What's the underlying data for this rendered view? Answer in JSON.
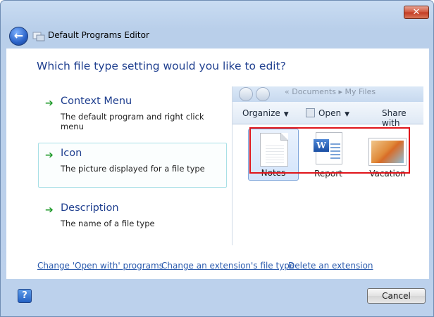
{
  "window": {
    "title": "Default Programs Editor",
    "close_label": "✕"
  },
  "main": {
    "heading": "Which file type setting would you like to edit?",
    "options": [
      {
        "title": "Context Menu",
        "description": "The default program and right click menu"
      },
      {
        "title": "Icon",
        "description": "The picture displayed for a file type",
        "selected": true
      },
      {
        "title": "Description",
        "description": "The name of a file type"
      }
    ]
  },
  "preview": {
    "address": "« Documents ▸ My Files",
    "toolbar": {
      "organize": "Organize",
      "open": "Open",
      "share": "Share with"
    },
    "files": [
      {
        "name": "Notes",
        "icon": "text-document-icon",
        "selected": true
      },
      {
        "name": "Report",
        "icon": "word-document-icon"
      },
      {
        "name": "Vacation",
        "icon": "photo-icon"
      }
    ]
  },
  "links": {
    "open_with": "Change 'Open with' programs",
    "change_type": "Change an extension's file type",
    "delete_ext": "Delete an extension"
  },
  "footer": {
    "help_label": "?",
    "cancel_label": "Cancel"
  },
  "colors": {
    "heading": "#1f3f8f",
    "link": "#2a5aad",
    "highlight": "#e0141a",
    "arrow": "#1f9a2a"
  }
}
